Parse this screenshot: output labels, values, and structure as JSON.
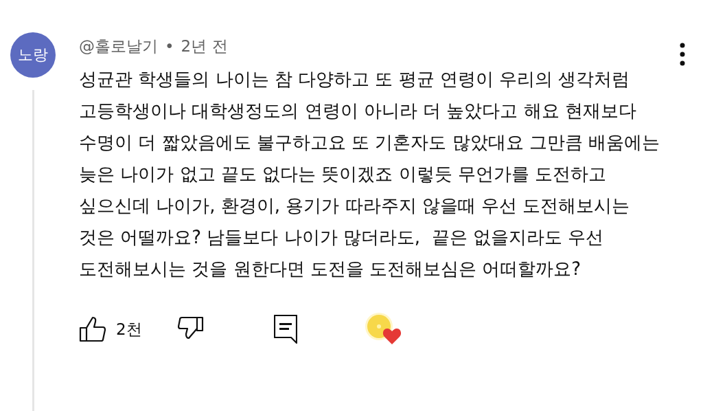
{
  "comment": {
    "avatar": {
      "initials": "노랑",
      "color": "#5c6bc0"
    },
    "author": "@홀로날기",
    "separator": "•",
    "time": "2년 전",
    "body": "성균관 학생들의 나이는 참 다양하고 또 평균 연령이 우리의 생각처럼 고등학생이나 대학생정도의 연령이 아니라 더 높았다고 해요 현재보다 수명이 더 짧았음에도 불구하고요 또 기혼자도 많았대요 그만큼 배움에는 늦은 나이가 없고 끝도 없다는 뜻이겠죠 이렇듯 무언가를 도전하고 싶으신데 나이가, 환경이, 용기가 따라주지 않을때 우선 도전해보시는 것은 어떨까요? 남들보다 나이가 많더라도,  끝은 없을지라도 우선 도전해보시는 것을 원한다면 도전을 도전해보심은 어떠할까요?",
    "likes": "2천",
    "creator_hearted": true
  }
}
